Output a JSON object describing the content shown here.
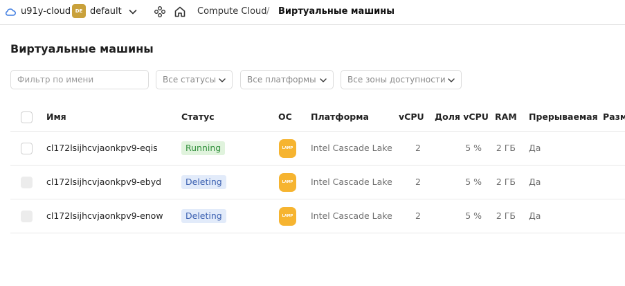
{
  "header": {
    "cloud_icon": "cloud-icon",
    "cloud_name": "u91y-cloud",
    "folder_badge": "DE",
    "folder_name": "default",
    "breadcrumb_service": "Compute Cloud",
    "breadcrumb_separator": "/",
    "breadcrumb_current": "Виртуальные машины",
    "accent_color": "#c9a13b"
  },
  "page": {
    "title": "Виртуальные машины"
  },
  "filters": {
    "name_placeholder": "Фильтр по имени",
    "name_value": "",
    "status": "Все статусы",
    "platform": "Все платформы",
    "zone": "Все зоны доступности"
  },
  "table": {
    "columns": {
      "name": "Имя",
      "status": "Статус",
      "os": "ОС",
      "platform": "Платформа",
      "vcpu": "vCPU",
      "vcpu_share": "Доля vCPU",
      "ram": "RAM",
      "preemptible": "Прерываемая",
      "size": "Разме"
    },
    "rows": [
      {
        "name": "cl172lsijhcvjaonkpv9-eqis",
        "status": "Running",
        "os_label": "LAMP",
        "platform": "Intel Cascade Lake",
        "vcpu": "2",
        "vcpu_share": "5 %",
        "ram": "2 ГБ",
        "preemptible": "Да"
      },
      {
        "name": "cl172lsijhcvjaonkpv9-ebyd",
        "status": "Deleting",
        "os_label": "LAMP",
        "platform": "Intel Cascade Lake",
        "vcpu": "2",
        "vcpu_share": "5 %",
        "ram": "2 ГБ",
        "preemptible": "Да"
      },
      {
        "name": "cl172lsijhcvjaonkpv9-enow",
        "status": "Deleting",
        "os_label": "LAMP",
        "platform": "Intel Cascade Lake",
        "vcpu": "2",
        "vcpu_share": "5 %",
        "ram": "2 ГБ",
        "preemptible": "Да"
      }
    ]
  },
  "colors": {
    "running_bg": "#e0f3dd",
    "running_text": "#2f8f3a",
    "deleting_bg": "#e2ebfa",
    "deleting_text": "#3a5fb0",
    "os_icon": "#f6b430"
  }
}
